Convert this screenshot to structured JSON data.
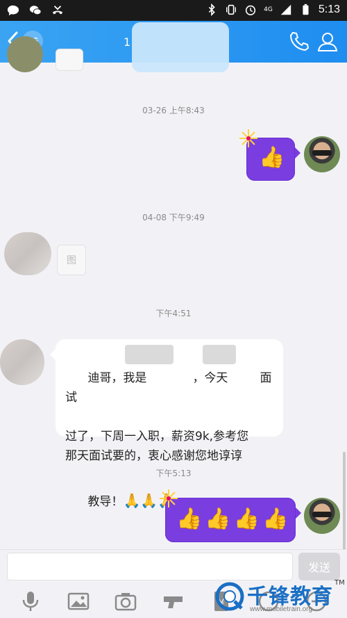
{
  "status_bar": {
    "time": "5:13",
    "network": "4G",
    "icons": [
      "message-icon",
      "wechat-icon",
      "missed-call-icon",
      "bluetooth-icon",
      "vibrate-icon",
      "alarm-icon",
      "signal-icon",
      "battery-icon"
    ]
  },
  "header": {
    "unread_count": "36",
    "title": "1",
    "icons": [
      "back-chevron-icon",
      "phone-icon",
      "profile-icon"
    ]
  },
  "messages": [
    {
      "type": "timestamp",
      "text": "03-26 上午8:43"
    },
    {
      "type": "sticker",
      "side": "right",
      "content": "👍",
      "count": 1
    },
    {
      "type": "timestamp",
      "text": "04-08 下午9:49"
    },
    {
      "type": "image",
      "side": "left",
      "placeholder": "图"
    },
    {
      "type": "timestamp",
      "text": "下午4:51"
    },
    {
      "type": "text",
      "side": "left",
      "line1_a": "迪哥，我是",
      "line1_b": "，今天",
      "line1_c": "面试",
      "line2": "过了，下周一入职，薪资9k,参考您",
      "line3": "那天面试要的，衷心感谢您地谆谆",
      "line4": "教导！",
      "emoji": "🙏🙏🙏"
    },
    {
      "type": "timestamp",
      "text": "下午5:13"
    },
    {
      "type": "sticker",
      "side": "right",
      "content": "👍👍👍👍",
      "count": 4
    }
  ],
  "input_bar": {
    "placeholder": "",
    "send_label": "发送"
  },
  "toolbar": {
    "items": [
      "mic-icon",
      "image-icon",
      "camera-icon",
      "gun-icon",
      "red-packet-icon",
      "emoji-icon",
      "plus-icon"
    ]
  },
  "watermark": {
    "text": "千锋教育",
    "url": "www.mobiletrain.org",
    "tm": "TM"
  },
  "colors": {
    "header_blue": "#1e8df0",
    "sticker_purple": "#7a3de0",
    "background": "#f2f2f6"
  }
}
